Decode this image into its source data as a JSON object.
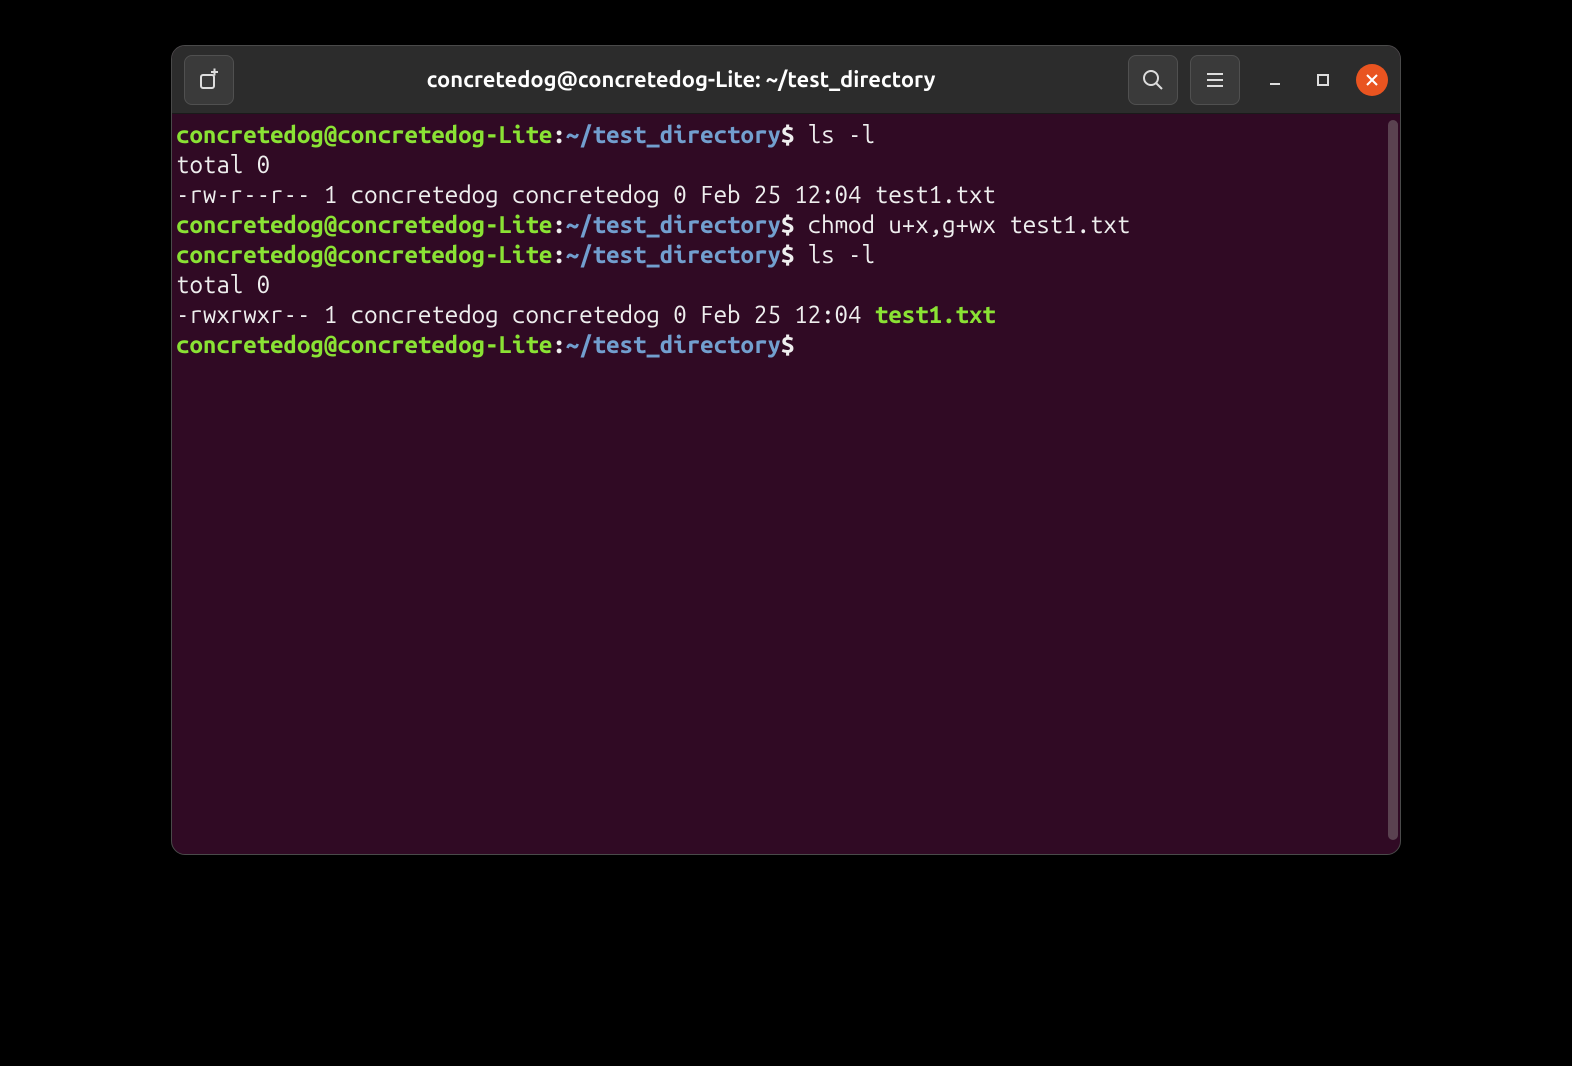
{
  "titlebar": {
    "title": "concretedog@concretedog-Lite: ~/test_directory"
  },
  "prompt": {
    "user_host": "concretedog@concretedog-Lite",
    "colon": ":",
    "path": "~/test_directory",
    "dollar": "$"
  },
  "lines": [
    {
      "type": "prompt",
      "cmd": " ls -l"
    },
    {
      "type": "output",
      "text": "total 0"
    },
    {
      "type": "output",
      "text": "-rw-r--r-- 1 concretedog concretedog 0 Feb 25 12:04 test1.txt"
    },
    {
      "type": "prompt",
      "cmd": " chmod u+x,g+wx test1.txt"
    },
    {
      "type": "prompt",
      "cmd": " ls -l"
    },
    {
      "type": "output",
      "text": "total 0"
    },
    {
      "type": "output_exec",
      "pre": "-rwxrwxr-- 1 concretedog concretedog 0 Feb 25 12:04 ",
      "file": "test1.txt"
    },
    {
      "type": "prompt",
      "cmd": " "
    }
  ]
}
